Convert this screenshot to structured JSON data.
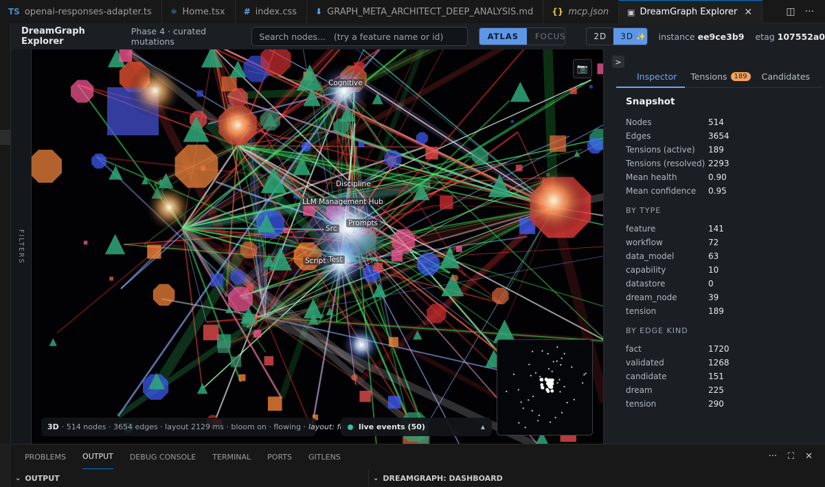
{
  "tabs": [
    {
      "icon": "TS",
      "label": "openai-responses-adapter.ts",
      "color": "#3a8fd6"
    },
    {
      "icon": "⚛",
      "label": "Home.tsx",
      "color": "#3fb6d8"
    },
    {
      "icon": "#",
      "label": "index.css",
      "color": "#5ea6e6"
    },
    {
      "icon": "⬇",
      "label": "GRAPH_META_ARCHITECT_DEEP_ANALYSIS.md",
      "color": "#5ea6e6"
    },
    {
      "icon": "{}",
      "label": "mcp.json",
      "color": "#e5c14a"
    },
    {
      "icon": "▣",
      "label": "DreamGraph Explorer",
      "close": "✕"
    }
  ],
  "header": {
    "title": "DreamGraph Explorer",
    "subtitle": "Phase 4 · curated mutations",
    "search_placeholder": "Search nodes...   (try a feature name or id)",
    "mode_atlas": "ATLAS",
    "mode_focus": "FOCUS",
    "view_2d": "2D",
    "view_3d": "3D",
    "instance_label": "instance",
    "instance_value": "ee9ce3b9",
    "etag_label": "etag",
    "etag_value": "107552a0"
  },
  "filters_label": "FILTERS",
  "canvas": {
    "labels": [
      {
        "text": "Cognitive"
      },
      {
        "text": "Discipline"
      },
      {
        "text": "LLM Management Hub"
      },
      {
        "text": "Src"
      },
      {
        "text": "Prompts"
      },
      {
        "text": "Scripts"
      },
      {
        "text": "Test"
      }
    ],
    "status_mode": "3D",
    "status_text": "· 514 nodes · 3654 edges · layout 2129 ms · bloom on · flowing ·",
    "status_layout": "layout: force",
    "live_events": "live events (50)"
  },
  "panel": {
    "collapse": ">",
    "tabs": {
      "inspector": "Inspector",
      "tensions": "Tensions",
      "tensions_count": "189",
      "candidates": "Candidates"
    },
    "snapshot_title": "Snapshot",
    "snapshot": [
      {
        "k": "Nodes",
        "v": "514"
      },
      {
        "k": "Edges",
        "v": "3654"
      },
      {
        "k": "Tensions (active)",
        "v": "189"
      },
      {
        "k": "Tensions (resolved)",
        "v": "2293"
      },
      {
        "k": "Mean health",
        "v": "0.90"
      },
      {
        "k": "Mean confidence",
        "v": "0.95"
      }
    ],
    "by_type_title": "BY TYPE",
    "by_type": [
      {
        "k": "feature",
        "v": "141"
      },
      {
        "k": "workflow",
        "v": "72"
      },
      {
        "k": "data_model",
        "v": "63"
      },
      {
        "k": "capability",
        "v": "10"
      },
      {
        "k": "datastore",
        "v": "0"
      },
      {
        "k": "dream_node",
        "v": "39"
      },
      {
        "k": "tension",
        "v": "189"
      }
    ],
    "by_edge_title": "BY EDGE KIND",
    "by_edge": [
      {
        "k": "fact",
        "v": "1720"
      },
      {
        "k": "validated",
        "v": "1268"
      },
      {
        "k": "candidate",
        "v": "151"
      },
      {
        "k": "dream",
        "v": "225"
      },
      {
        "k": "tension",
        "v": "290"
      }
    ]
  },
  "bottom": {
    "tabs": [
      "PROBLEMS",
      "OUTPUT",
      "DEBUG CONSOLE",
      "TERMINAL",
      "PORTS",
      "GITLENS"
    ],
    "active": "OUTPUT",
    "section_left": "OUTPUT",
    "section_right": "DREAMGRAPH: DASHBOARD",
    "more": "···"
  }
}
